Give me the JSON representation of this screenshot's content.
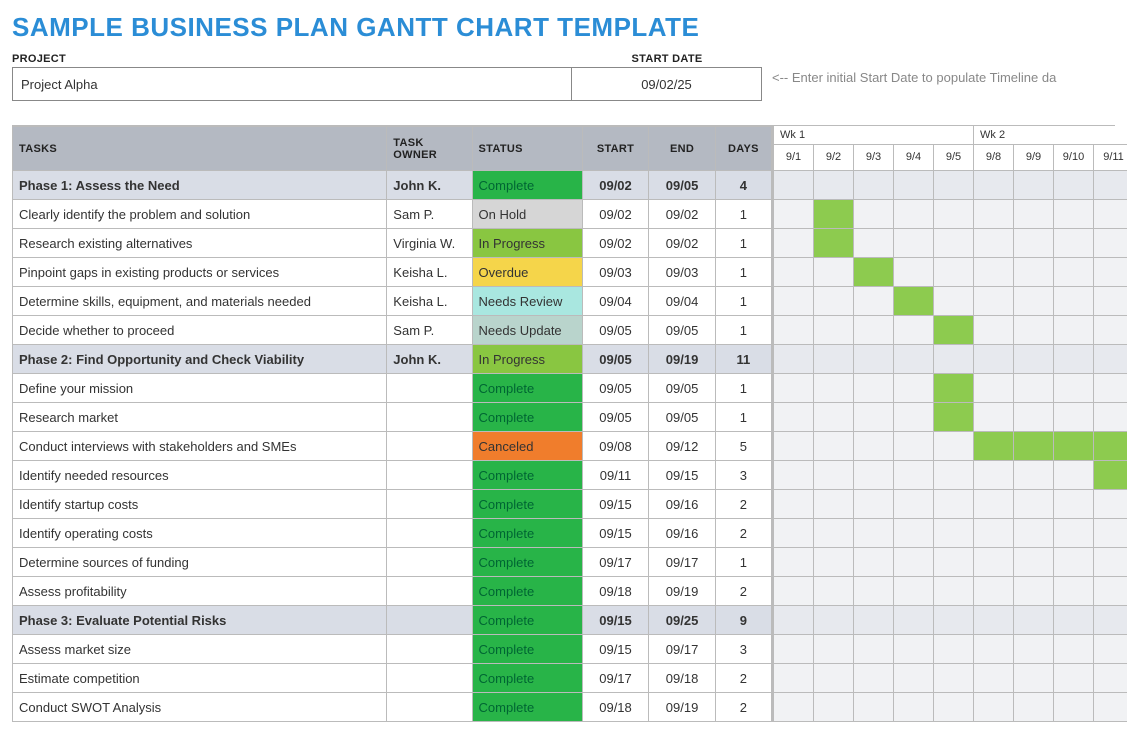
{
  "title": "SAMPLE BUSINESS PLAN GANTT CHART TEMPLATE",
  "meta": {
    "project_label": "PROJECT",
    "project_name": "Project Alpha",
    "startdate_label": "START DATE",
    "startdate_value": "09/02/25",
    "hint": "<-- Enter initial Start Date to populate Timeline da"
  },
  "columns": {
    "tasks": "TASKS",
    "owner": "TASK OWNER",
    "status": "STATUS",
    "start": "START",
    "end": "END",
    "days": "DAYS"
  },
  "timeline": {
    "weeks": [
      {
        "label": "Wk 1",
        "span": 5
      },
      {
        "label": "Wk 2",
        "span": 4
      }
    ],
    "days": [
      "9/1",
      "9/2",
      "9/3",
      "9/4",
      "9/5",
      "9/8",
      "9/9",
      "9/10",
      "9/11"
    ]
  },
  "status_styles": {
    "Complete": "st-complete",
    "On Hold": "st-onhold",
    "In Progress": "st-inprogress",
    "Overdue": "st-overdue",
    "Needs Review": "st-needsreview",
    "Needs Update": "st-needsupdate",
    "Canceled": "st-canceled"
  },
  "rows": [
    {
      "type": "phase",
      "task": "Phase 1: Assess the Need",
      "owner": "John K.",
      "status": "Complete",
      "start": "09/02",
      "end": "09/05",
      "days": "4",
      "bar": [
        1,
        4
      ],
      "barClass": "bar-phase"
    },
    {
      "type": "task",
      "task": "Clearly identify the problem and solution",
      "owner": "Sam P.",
      "status": "On Hold",
      "start": "09/02",
      "end": "09/02",
      "days": "1",
      "bar": [
        1,
        1
      ],
      "barClass": "bar-task"
    },
    {
      "type": "task",
      "task": "Research existing alternatives",
      "owner": "Virginia W.",
      "status": "In Progress",
      "start": "09/02",
      "end": "09/02",
      "days": "1",
      "bar": [
        1,
        1
      ],
      "barClass": "bar-task"
    },
    {
      "type": "task",
      "task": "Pinpoint gaps in existing products or services",
      "owner": "Keisha L.",
      "status": "Overdue",
      "start": "09/03",
      "end": "09/03",
      "days": "1",
      "bar": [
        2,
        2
      ],
      "barClass": "bar-task"
    },
    {
      "type": "task",
      "task": "Determine skills, equipment, and materials needed",
      "owner": "Keisha L.",
      "status": "Needs Review",
      "start": "09/04",
      "end": "09/04",
      "days": "1",
      "bar": [
        3,
        3
      ],
      "barClass": "bar-task"
    },
    {
      "type": "task",
      "task": "Decide whether to proceed",
      "owner": "Sam P.",
      "status": "Needs Update",
      "start": "09/05",
      "end": "09/05",
      "days": "1",
      "bar": [
        4,
        4
      ],
      "barClass": "bar-task"
    },
    {
      "type": "phase",
      "task": "Phase 2: Find Opportunity and Check Viability",
      "owner": "John K.",
      "status": "In Progress",
      "start": "09/05",
      "end": "09/19",
      "days": "11",
      "bar": [
        4,
        8
      ],
      "barClass": "bar-phase"
    },
    {
      "type": "task",
      "task": "Define your mission",
      "owner": "",
      "status": "Complete",
      "start": "09/05",
      "end": "09/05",
      "days": "1",
      "bar": [
        4,
        4
      ],
      "barClass": "bar-task"
    },
    {
      "type": "task",
      "task": "Research market",
      "owner": "",
      "status": "Complete",
      "start": "09/05",
      "end": "09/05",
      "days": "1",
      "bar": [
        4,
        4
      ],
      "barClass": "bar-task"
    },
    {
      "type": "task",
      "task": "Conduct interviews with stakeholders and SMEs",
      "owner": "",
      "status": "Canceled",
      "start": "09/08",
      "end": "09/12",
      "days": "5",
      "bar": [
        5,
        8
      ],
      "barClass": "bar-task"
    },
    {
      "type": "task",
      "task": "Identify needed resources",
      "owner": "",
      "status": "Complete",
      "start": "09/11",
      "end": "09/15",
      "days": "3",
      "bar": [
        8,
        8
      ],
      "barClass": "bar-task"
    },
    {
      "type": "task",
      "task": "Identify startup costs",
      "owner": "",
      "status": "Complete",
      "start": "09/15",
      "end": "09/16",
      "days": "2",
      "bar": null
    },
    {
      "type": "task",
      "task": "Identify operating costs",
      "owner": "",
      "status": "Complete",
      "start": "09/15",
      "end": "09/16",
      "days": "2",
      "bar": null
    },
    {
      "type": "task",
      "task": "Determine sources of funding",
      "owner": "",
      "status": "Complete",
      "start": "09/17",
      "end": "09/17",
      "days": "1",
      "bar": null
    },
    {
      "type": "task",
      "task": "Assess profitability",
      "owner": "",
      "status": "Complete",
      "start": "09/18",
      "end": "09/19",
      "days": "2",
      "bar": null
    },
    {
      "type": "phase",
      "task": "Phase 3: Evaluate Potential Risks",
      "owner": "",
      "status": "Complete",
      "start": "09/15",
      "end": "09/25",
      "days": "9",
      "bar": null
    },
    {
      "type": "task",
      "task": "Assess market size",
      "owner": "",
      "status": "Complete",
      "start": "09/15",
      "end": "09/17",
      "days": "3",
      "bar": null
    },
    {
      "type": "task",
      "task": "Estimate competition",
      "owner": "",
      "status": "Complete",
      "start": "09/17",
      "end": "09/18",
      "days": "2",
      "bar": null
    },
    {
      "type": "task",
      "task": "Conduct SWOT Analysis",
      "owner": "",
      "status": "Complete",
      "start": "09/18",
      "end": "09/19",
      "days": "2",
      "bar": null
    }
  ],
  "chart_data": {
    "type": "gantt",
    "title": "Sample Business Plan Gantt Chart",
    "date_axis": [
      "9/1",
      "9/2",
      "9/3",
      "9/4",
      "9/5",
      "9/8",
      "9/9",
      "9/10",
      "9/11"
    ],
    "tasks": [
      {
        "name": "Phase 1: Assess the Need",
        "start": "09/02",
        "end": "09/05",
        "days": 4,
        "phase": true
      },
      {
        "name": "Clearly identify the problem and solution",
        "start": "09/02",
        "end": "09/02",
        "days": 1
      },
      {
        "name": "Research existing alternatives",
        "start": "09/02",
        "end": "09/02",
        "days": 1
      },
      {
        "name": "Pinpoint gaps in existing products or services",
        "start": "09/03",
        "end": "09/03",
        "days": 1
      },
      {
        "name": "Determine skills, equipment, and materials needed",
        "start": "09/04",
        "end": "09/04",
        "days": 1
      },
      {
        "name": "Decide whether to proceed",
        "start": "09/05",
        "end": "09/05",
        "days": 1
      },
      {
        "name": "Phase 2: Find Opportunity and Check Viability",
        "start": "09/05",
        "end": "09/19",
        "days": 11,
        "phase": true
      },
      {
        "name": "Define your mission",
        "start": "09/05",
        "end": "09/05",
        "days": 1
      },
      {
        "name": "Research market",
        "start": "09/05",
        "end": "09/05",
        "days": 1
      },
      {
        "name": "Conduct interviews with stakeholders and SMEs",
        "start": "09/08",
        "end": "09/12",
        "days": 5
      },
      {
        "name": "Identify needed resources",
        "start": "09/11",
        "end": "09/15",
        "days": 3
      },
      {
        "name": "Identify startup costs",
        "start": "09/15",
        "end": "09/16",
        "days": 2
      },
      {
        "name": "Identify operating costs",
        "start": "09/15",
        "end": "09/16",
        "days": 2
      },
      {
        "name": "Determine sources of funding",
        "start": "09/17",
        "end": "09/17",
        "days": 1
      },
      {
        "name": "Assess profitability",
        "start": "09/18",
        "end": "09/19",
        "days": 2
      },
      {
        "name": "Phase 3: Evaluate Potential Risks",
        "start": "09/15",
        "end": "09/25",
        "days": 9,
        "phase": true
      },
      {
        "name": "Assess market size",
        "start": "09/15",
        "end": "09/17",
        "days": 3
      },
      {
        "name": "Estimate competition",
        "start": "09/17",
        "end": "09/18",
        "days": 2
      },
      {
        "name": "Conduct SWOT Analysis",
        "start": "09/18",
        "end": "09/19",
        "days": 2
      }
    ]
  }
}
